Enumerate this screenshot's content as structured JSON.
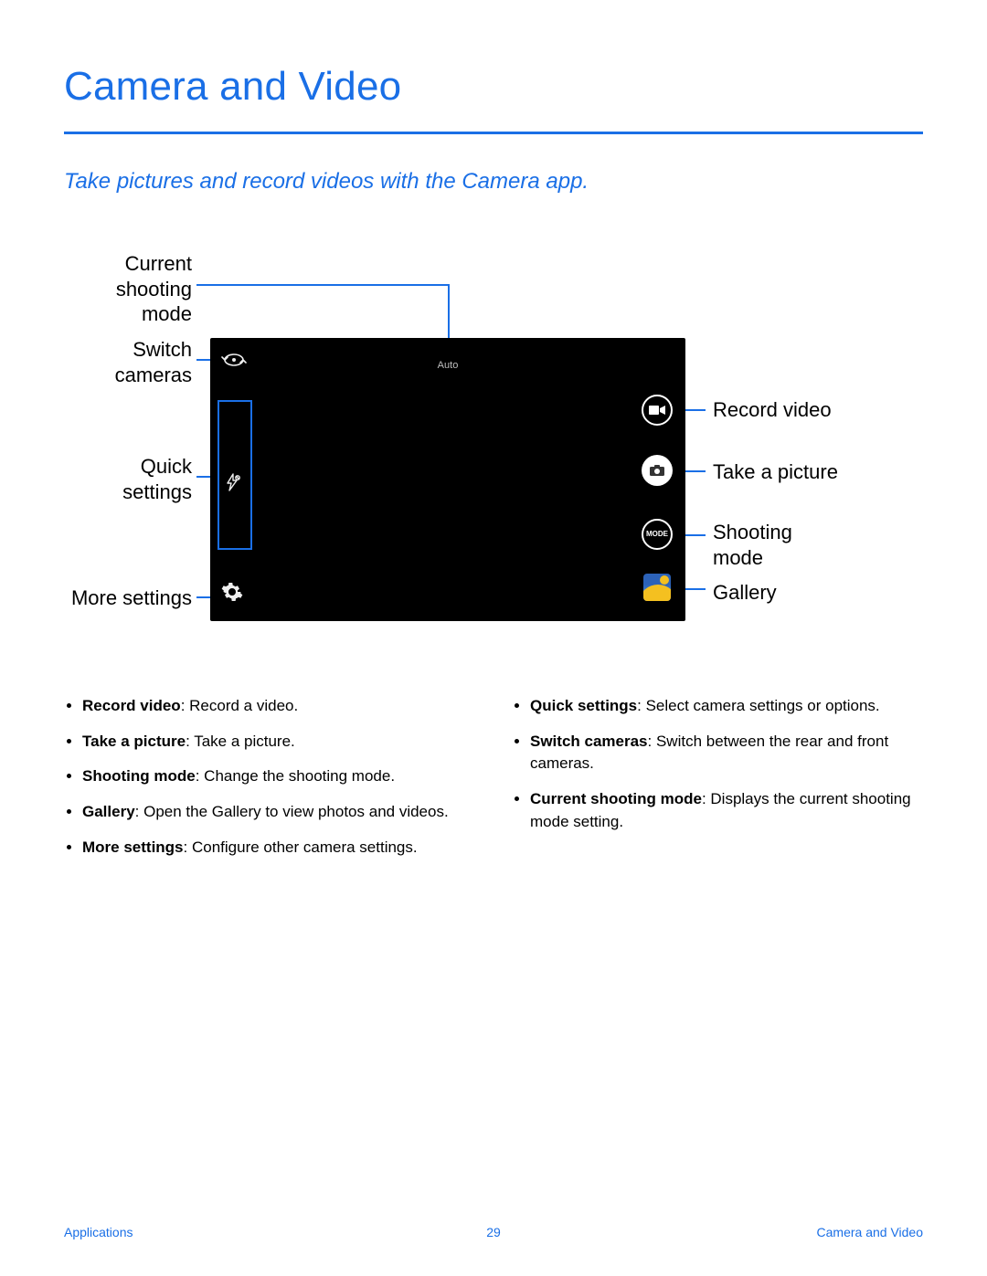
{
  "title": "Camera and Video",
  "subtitle": "Take pictures and record videos with the Camera app.",
  "diagram": {
    "mode_text": "Auto",
    "mode_btn": "MODE",
    "callouts": {
      "current_mode_l1": "Current",
      "current_mode_l2": "shooting",
      "current_mode_l3": "mode",
      "switch_l1": "Switch",
      "switch_l2": "cameras",
      "quick_l1": "Quick",
      "quick_l2": "settings",
      "more_settings": "More settings",
      "record_video": "Record video",
      "take_picture": "Take a picture",
      "shooting_l1": "Shooting",
      "shooting_l2": "mode",
      "gallery": "Gallery"
    }
  },
  "bullets_left": [
    {
      "term": "Record video",
      "desc": ": Record a video."
    },
    {
      "term": "Take a picture",
      "desc": ": Take a picture."
    },
    {
      "term": "Shooting mode",
      "desc": ": Change the shooting mode."
    },
    {
      "term": "Gallery",
      "desc": ": Open the Gallery to view photos and videos."
    },
    {
      "term": "More settings",
      "desc": ": Configure other camera settings."
    }
  ],
  "bullets_right": [
    {
      "term": "Quick settings",
      "desc": ": Select camera settings or options."
    },
    {
      "term": "Switch cameras",
      "desc": ": Switch between the rear and front cameras."
    },
    {
      "term": "Current shooting mode",
      "desc": ": Displays the current shooting mode setting."
    }
  ],
  "footer": {
    "left": "Applications",
    "center": "29",
    "right": "Camera and Video"
  }
}
